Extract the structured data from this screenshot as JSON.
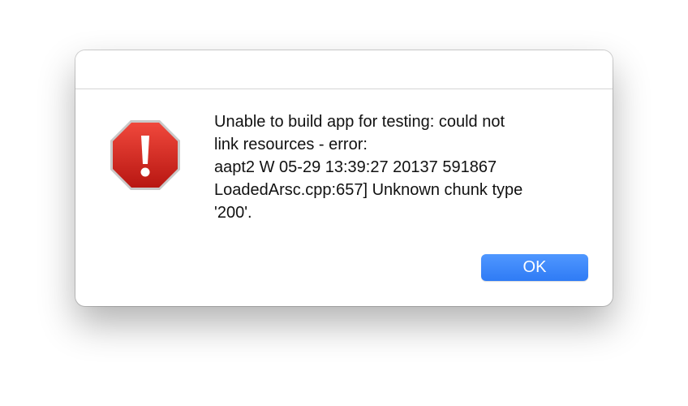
{
  "dialog": {
    "message": "Unable to build app for testing: could not\nlink resources - error:\naapt2 W 05-29 13:39:27 20137 591867\nLoadedArsc.cpp:657] Unknown chunk type\n'200'.",
    "icon": "alert-stop-icon",
    "ok_label": "OK"
  },
  "colors": {
    "accent": "#3a86f7",
    "icon_red": "#d02a20"
  }
}
